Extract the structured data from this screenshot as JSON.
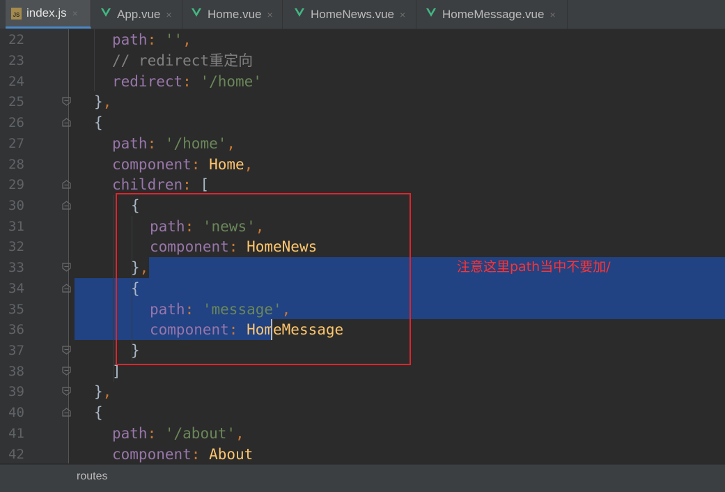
{
  "tabs": [
    {
      "label": "index.js",
      "type": "js",
      "active": true
    },
    {
      "label": "App.vue",
      "type": "vue",
      "active": false
    },
    {
      "label": "Home.vue",
      "type": "vue",
      "active": false
    },
    {
      "label": "HomeNews.vue",
      "type": "vue",
      "active": false
    },
    {
      "label": "HomeMessage.vue",
      "type": "vue",
      "active": false
    }
  ],
  "tab_close_glyph": "×",
  "js_icon_label": "JS",
  "line_numbers": [
    "22",
    "23",
    "24",
    "25",
    "26",
    "27",
    "28",
    "29",
    "30",
    "31",
    "32",
    "33",
    "34",
    "35",
    "36",
    "37",
    "38",
    "39",
    "40",
    "41",
    "42"
  ],
  "code": [
    {
      "indent": 2,
      "tokens": [
        [
          "kp",
          "path"
        ],
        [
          "punc",
          ": "
        ],
        [
          "str",
          "''"
        ],
        [
          "punc",
          ","
        ]
      ]
    },
    {
      "indent": 2,
      "tokens": [
        [
          "cmt",
          "// redirect重定向"
        ]
      ]
    },
    {
      "indent": 2,
      "tokens": [
        [
          "kp",
          "redirect"
        ],
        [
          "punc",
          ": "
        ],
        [
          "str",
          "'/home'"
        ]
      ]
    },
    {
      "indent": 1,
      "tokens": [
        [
          "plain",
          "}"
        ],
        [
          "punc",
          ","
        ]
      ]
    },
    {
      "indent": 1,
      "tokens": [
        [
          "plain",
          "{"
        ]
      ]
    },
    {
      "indent": 2,
      "tokens": [
        [
          "kp",
          "path"
        ],
        [
          "punc",
          ": "
        ],
        [
          "str",
          "'/home'"
        ],
        [
          "punc",
          ","
        ]
      ]
    },
    {
      "indent": 2,
      "tokens": [
        [
          "kp",
          "component"
        ],
        [
          "punc",
          ": "
        ],
        [
          "ident",
          "Home"
        ],
        [
          "punc",
          ","
        ]
      ]
    },
    {
      "indent": 2,
      "tokens": [
        [
          "kp",
          "children"
        ],
        [
          "punc",
          ": "
        ],
        [
          "plain",
          "["
        ]
      ]
    },
    {
      "indent": 3,
      "tokens": [
        [
          "plain",
          "{"
        ]
      ]
    },
    {
      "indent": 4,
      "tokens": [
        [
          "kp",
          "path"
        ],
        [
          "punc",
          ": "
        ],
        [
          "str",
          "'news'"
        ],
        [
          "punc",
          ","
        ]
      ]
    },
    {
      "indent": 4,
      "tokens": [
        [
          "kp",
          "component"
        ],
        [
          "punc",
          ": "
        ],
        [
          "ident",
          "HomeNews"
        ]
      ]
    },
    {
      "indent": 3,
      "tokens": [
        [
          "plain",
          "}"
        ],
        [
          "punc",
          ","
        ]
      ]
    },
    {
      "indent": 3,
      "tokens": [
        [
          "plain",
          "{"
        ]
      ]
    },
    {
      "indent": 4,
      "tokens": [
        [
          "kp",
          "path"
        ],
        [
          "punc",
          ": "
        ],
        [
          "str",
          "'message'"
        ],
        [
          "punc",
          ","
        ]
      ]
    },
    {
      "indent": 4,
      "tokens": [
        [
          "kp",
          "component"
        ],
        [
          "punc",
          ": "
        ],
        [
          "ident",
          "HomeMessage"
        ]
      ]
    },
    {
      "indent": 3,
      "tokens": [
        [
          "plain",
          "}"
        ]
      ]
    },
    {
      "indent": 2,
      "tokens": [
        [
          "plain",
          "]"
        ]
      ]
    },
    {
      "indent": 1,
      "tokens": [
        [
          "plain",
          "}"
        ],
        [
          "punc",
          ","
        ]
      ]
    },
    {
      "indent": 1,
      "tokens": [
        [
          "plain",
          "{"
        ]
      ]
    },
    {
      "indent": 2,
      "tokens": [
        [
          "kp",
          "path"
        ],
        [
          "punc",
          ": "
        ],
        [
          "str",
          "'/about'"
        ],
        [
          "punc",
          ","
        ]
      ]
    },
    {
      "indent": 2,
      "tokens": [
        [
          "kp",
          "component"
        ],
        [
          "punc",
          ": "
        ],
        [
          "ident",
          "About"
        ]
      ]
    }
  ],
  "annotation": {
    "note": "注意这里path当中不要加/",
    "color": "#ff3333"
  },
  "breadcrumb": "routes",
  "colors": {
    "background": "#2b2b2b",
    "gutter": "#313335",
    "selection": "#214283",
    "property": "#9876aa",
    "string": "#6a8759",
    "comment": "#808080",
    "punctuation": "#cc7832",
    "identifier": "#ffc66d",
    "vue_icon": "#41b883"
  }
}
